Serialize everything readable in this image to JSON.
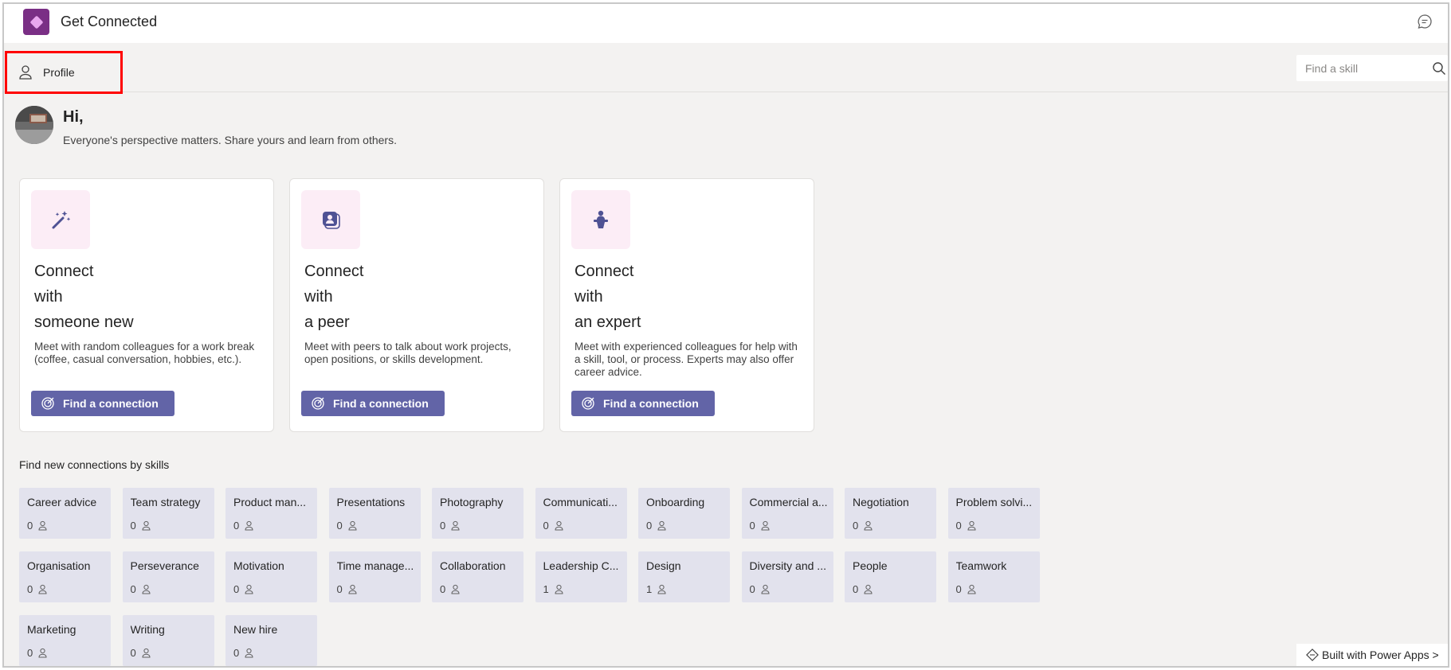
{
  "app": {
    "title": "Get Connected"
  },
  "toolbar": {
    "profile_label": "Profile",
    "search_placeholder": "Find a skill"
  },
  "greeting": {
    "title": "Hi,",
    "subtitle": "Everyone's perspective matters. Share yours and learn from others."
  },
  "cards": [
    {
      "icon": "magic-wand-icon",
      "title_lines": [
        "Connect",
        "with",
        "someone new"
      ],
      "description": "Meet with random colleagues for a work break (coffee, casual conversation, hobbies, etc.).",
      "button_label": "Find a connection"
    },
    {
      "icon": "peer-people-icon",
      "title_lines": [
        "Connect",
        "with",
        "a peer"
      ],
      "description": "Meet with peers to talk about work projects, open positions, or skills development.",
      "button_label": "Find a connection"
    },
    {
      "icon": "expert-presenter-icon",
      "title_lines": [
        "Connect",
        "with",
        "an expert"
      ],
      "description": "Meet with experienced colleagues for help with a skill, tool, or process. Experts may also offer career advice.",
      "button_label": "Find a connection"
    }
  ],
  "skills": {
    "heading": "Find new connections by skills",
    "items": [
      {
        "name": "Career advice",
        "count": "0"
      },
      {
        "name": "Team strategy",
        "count": "0"
      },
      {
        "name": "Product man...",
        "count": "0"
      },
      {
        "name": "Presentations",
        "count": "0"
      },
      {
        "name": "Photography",
        "count": "0"
      },
      {
        "name": "Communicati...",
        "count": "0"
      },
      {
        "name": "Onboarding",
        "count": "0"
      },
      {
        "name": "Commercial a...",
        "count": "0"
      },
      {
        "name": "Negotiation",
        "count": "0"
      },
      {
        "name": "Problem solvi...",
        "count": "0"
      },
      {
        "name": "Organisation",
        "count": "0"
      },
      {
        "name": "Perseverance",
        "count": "0"
      },
      {
        "name": "Motivation",
        "count": "0"
      },
      {
        "name": "Time manage...",
        "count": "0"
      },
      {
        "name": "Collaboration",
        "count": "0"
      },
      {
        "name": "Leadership C...",
        "count": "1"
      },
      {
        "name": "Design",
        "count": "1"
      },
      {
        "name": "Diversity and ...",
        "count": "0"
      },
      {
        "name": "People",
        "count": "0"
      },
      {
        "name": "Teamwork",
        "count": "0"
      },
      {
        "name": "Marketing",
        "count": "0"
      },
      {
        "name": "Writing",
        "count": "0"
      },
      {
        "name": "New hire",
        "count": "0"
      }
    ]
  },
  "footer": {
    "built_with_label": "Built with Power Apps >"
  },
  "colors": {
    "accent": "#6264a7",
    "brand": "#7a2f85",
    "icon_tile": "#fcedf6",
    "skill_tile": "#e2e2ed",
    "highlight_border": "#ff0000"
  }
}
